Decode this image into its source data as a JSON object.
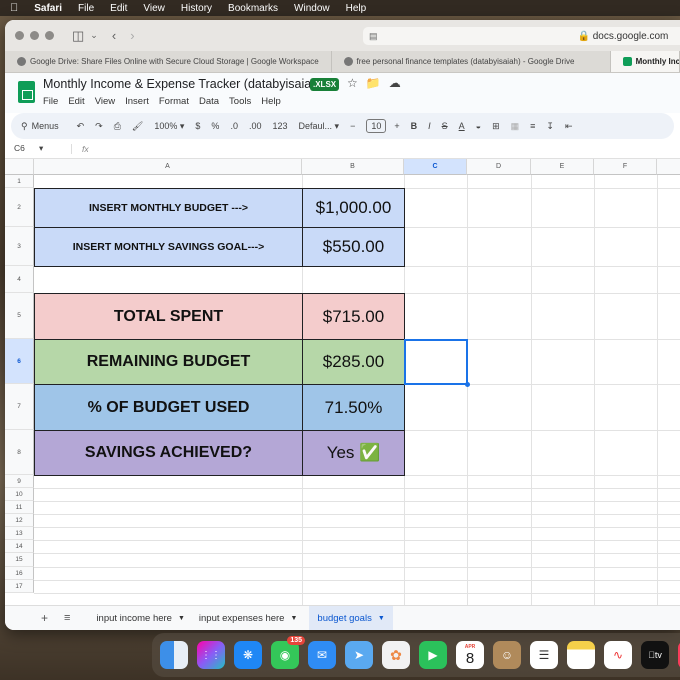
{
  "menubar": {
    "app": "Safari",
    "items": [
      "File",
      "Edit",
      "View",
      "History",
      "Bookmarks",
      "Window",
      "Help"
    ]
  },
  "browser": {
    "url": "docs.google.com",
    "tabs": [
      {
        "label": "Google Drive: Share Files Online with Secure Cloud Storage | Google Workspace"
      },
      {
        "label": "free personal finance templates (databyisaiah) - Google Drive"
      },
      {
        "label": "Monthly Incom"
      }
    ]
  },
  "doc": {
    "title": "Monthly Income & Expense Tracker (databyisaiah)",
    "badge": ".XLSX",
    "menus": [
      "File",
      "Edit",
      "View",
      "Insert",
      "Format",
      "Data",
      "Tools",
      "Help"
    ]
  },
  "toolbar": {
    "search": "Menus",
    "zoom": "100%",
    "currency": "$",
    "percent": "%",
    "dec_less": ".0",
    "dec_more": ".00",
    "num_format": "123",
    "font": "Defaul...",
    "font_size": "10",
    "minus": "−",
    "plus": "+",
    "bold": "B",
    "italic": "I",
    "strike": "S",
    "text_color": "A"
  },
  "formula_bar": {
    "cell_ref": "C6",
    "fx": "fx",
    "value": ""
  },
  "grid": {
    "columns": [
      "A",
      "B",
      "C",
      "D",
      "E",
      "F"
    ],
    "rows": [
      "1",
      "2",
      "3",
      "4",
      "5",
      "6",
      "7",
      "8",
      "9",
      "10",
      "11",
      "12",
      "13",
      "14",
      "15",
      "16",
      "17"
    ],
    "selected_cell": "C6"
  },
  "cells": {
    "a2": "INSERT MONTHLY BUDGET --->",
    "b2": "$1,000.00",
    "a3": "INSERT MONTHLY SAVINGS GOAL--->",
    "b3": "$550.00",
    "a5": "TOTAL SPENT",
    "b5": "$715.00",
    "a6": "REMAINING BUDGET",
    "b6": "$285.00",
    "a7": "% OF BUDGET USED",
    "b7": "71.50%",
    "a8": "SAVINGS ACHIEVED?",
    "b8": "Yes ✅"
  },
  "colors": {
    "blue_fill": "#c9daf8",
    "pink_fill": "#f4cccc",
    "green_fill": "#b6d7a8",
    "mid_blue_fill": "#9fc5e8",
    "purple_fill": "#b4a7d6"
  },
  "sheet_tabs": [
    {
      "label": "input income here",
      "active": false
    },
    {
      "label": "input expenses here",
      "active": false
    },
    {
      "label": "budget goals",
      "active": true
    }
  ],
  "dock": {
    "messages_badge": "135",
    "calendar_month": "APR",
    "calendar_day": "8",
    "tv_label": "tv"
  }
}
